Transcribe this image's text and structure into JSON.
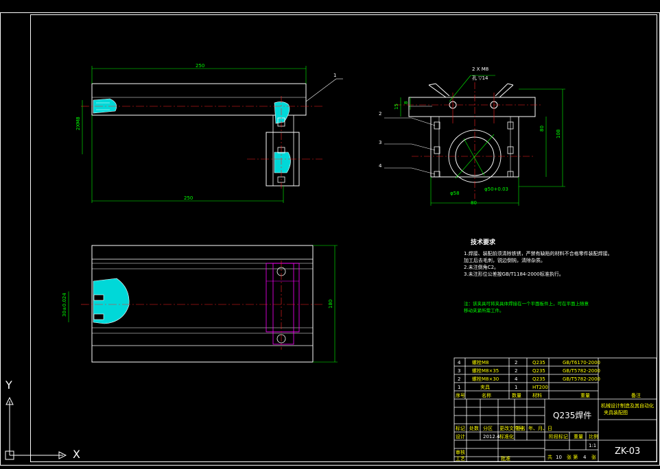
{
  "drawing": {
    "front_view": {
      "dim_top": "250",
      "dim_bottom": "250",
      "dim_left": "2XM8",
      "part_callout": "1"
    },
    "side_view": {
      "thread_note_1": "2 X M8",
      "thread_note_2": "孔 ▽14",
      "dim_height_outer": "108",
      "dim_height_inner": "80",
      "dim_width": "80",
      "dim_small_left": "15",
      "dim_small_left2": "8",
      "dim_dia_1": "φ58",
      "dim_dia_2": "φ50+0.03",
      "callouts": [
        "2",
        "3",
        "4"
      ]
    },
    "top_view": {
      "dim_right": "180",
      "dim_left": "30±0.024"
    },
    "technical_requirements": {
      "title": "技术要求",
      "lines": [
        "1.焊接、装配前须清除铁锈，严禁有缺陷的材料不合格零件装配焊接。",
        "加工后去毛刺，锐边倒钝，清除杂质。",
        "2.未注倒角C2。",
        "3.未注形位公差按GB/T1184-2000标准执行。"
      ]
    },
    "note": {
      "lines": [
        "注：该夹具可将夹具体焊接在一个平面板件上，可在平面上随意",
        "移动夹紧所需工件。"
      ]
    }
  },
  "bom": {
    "rows": [
      {
        "no": "4",
        "name": "螺栓M8",
        "qty": "2",
        "material": "Q235",
        "std": "GB/T6170-2000"
      },
      {
        "no": "3",
        "name": "螺栓M8×35",
        "qty": "2",
        "material": "Q235",
        "std": "GB/T5782-2000"
      },
      {
        "no": "2",
        "name": "螺栓M8×30",
        "qty": "4",
        "material": "Q235",
        "std": "GB/T5782-2000"
      },
      {
        "no": "1",
        "name": "夹具",
        "qty": "1",
        "material": "HT200",
        "std": ""
      }
    ],
    "header": {
      "no": "序号",
      "name": "名称",
      "qty": "数量",
      "material": "材料",
      "weight": "重量",
      "remark": "备注"
    }
  },
  "title_block": {
    "material": "Q235焊件",
    "company": "机械设计制造及其自动化",
    "drawing_title": "夹具装配图",
    "drawing_no": "ZK-03",
    "scale_label": "比例",
    "scale": "1:1",
    "designer_label": "设计",
    "date": "2012.4",
    "sheet_total_label": "共",
    "sheet_total": "10",
    "sheet_label": "张 第",
    "sheet_no": "4",
    "sheet_suffix": "张",
    "labels": {
      "mark": "标记",
      "count": "处数",
      "zone": "分区",
      "change_no": "更改文件号",
      "sign": "签名",
      "ymd": "年、月、日",
      "standard": "标准化",
      "review": "审核",
      "process": "工艺",
      "approve": "批准",
      "stage": "阶段标记",
      "weight": "重量"
    }
  },
  "ucs": {
    "x": "X",
    "y": "Y"
  },
  "colors": {
    "background": "#000000",
    "lines": "#ffffff",
    "dimensions": "#00ff00",
    "centerlines": "#ff0000",
    "hatch": "#00ffff",
    "hidden": "#ff00ff"
  }
}
